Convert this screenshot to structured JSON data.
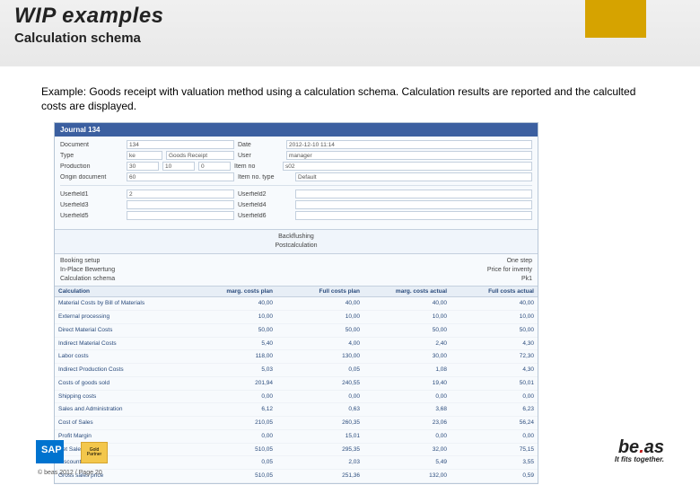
{
  "header": {
    "title": "WIP examples",
    "subtitle": "Calculation schema"
  },
  "intro": "Example: Goods receipt with valuation method using a calculation schema. Calculation results are reported and the calculted costs are displayed.",
  "panel": {
    "title": "Journal 134",
    "form": {
      "document_l": "Document",
      "document_v": "134",
      "date_l": "Date",
      "date_v": "2012-12-10 11:14",
      "type_l": "Type",
      "type_v": "ke",
      "type_r": "Goods Receipt",
      "user_l": "User",
      "user_v": "manager",
      "production_l": "Production",
      "production_v1": "30",
      "production_v2": "10",
      "production_v3": "0",
      "item_l": "Item no",
      "item_v": "s02",
      "origind_l": "Origin document",
      "origind_v": "60",
      "itemt_l": "Item no. type",
      "itemt_v": "Default",
      "uf1_l": "Userfield1",
      "uf1_v": "2",
      "uf2_l": "Userfield2",
      "uf3_l": "Userfield3",
      "uf4_l": "Userfield4",
      "uf5_l": "Userfield5",
      "uf6_l": "Userfield6"
    },
    "mid": {
      "a": "Backflushing",
      "b": "Postcalculation"
    },
    "meta": {
      "r1l": "Booking setup",
      "r1r": "One step",
      "r2l": "In-Place Bewertung",
      "r2r": "Price for inventy",
      "r3l": "Calculation schema",
      "r3r": "Pk1"
    },
    "tableHeader": {
      "c0": "Calculation",
      "c1": "marg. costs plan",
      "c2": "Full costs plan",
      "c3": "marg. costs actual",
      "c4": "Full costs actual"
    },
    "rows": [
      {
        "c0": "Material Costs by Bill of Materials",
        "c1": "40,00",
        "c2": "40,00",
        "c3": "40,00",
        "c4": "40,00"
      },
      {
        "c0": "External processing",
        "c1": "10,00",
        "c2": "10,00",
        "c3": "10,00",
        "c4": "10,00"
      },
      {
        "c0": "Direct Material Costs",
        "c1": "50,00",
        "c2": "50,00",
        "c3": "50,00",
        "c4": "50,00"
      },
      {
        "c0": "Indirect Material Costs",
        "c1": "5,40",
        "c2": "4,00",
        "c3": "2,40",
        "c4": "4,30"
      },
      {
        "c0": "Labor costs",
        "c1": "118,00",
        "c2": "130,00",
        "c3": "30,00",
        "c4": "72,30"
      },
      {
        "c0": "Indirect Production Costs",
        "c1": "5,03",
        "c2": "0,05",
        "c3": "1,08",
        "c4": "4,30"
      },
      {
        "c0": "Costs of goods sold",
        "c1": "201,94",
        "c2": "240,55",
        "c3": "19,40",
        "c4": "50,01"
      },
      {
        "c0": "Shipping costs",
        "c1": "0,00",
        "c2": "0,00",
        "c3": "0,00",
        "c4": "0,00"
      },
      {
        "c0": "Sales and Administration",
        "c1": "6,12",
        "c2": "0,63",
        "c3": "3,68",
        "c4": "6,23"
      },
      {
        "c0": "Cost of Sales",
        "c1": "210,05",
        "c2": "260,35",
        "c3": "23,06",
        "c4": "56,24"
      },
      {
        "c0": "Profit Margin",
        "c1": "0,00",
        "c2": "15,01",
        "c3": "0,00",
        "c4": "0,00"
      },
      {
        "c0": "Net Sales Price",
        "c1": "510,05",
        "c2": "295,35",
        "c3": "32,00",
        "c4": "75,15"
      },
      {
        "c0": "Discount",
        "c1": "0,05",
        "c2": "2,03",
        "c3": "5,49",
        "c4": "3,55"
      },
      {
        "c0": "Gross sales price",
        "c1": "510,05",
        "c2": "251,36",
        "c3": "132,00",
        "c4": "0,59"
      }
    ]
  },
  "footer": {
    "gold": "Gold Partner",
    "copy": "© beas 2012 / Page 20",
    "brand1": "be",
    "brandR": ".",
    "brand2": "as",
    "tag": "It fits together."
  }
}
